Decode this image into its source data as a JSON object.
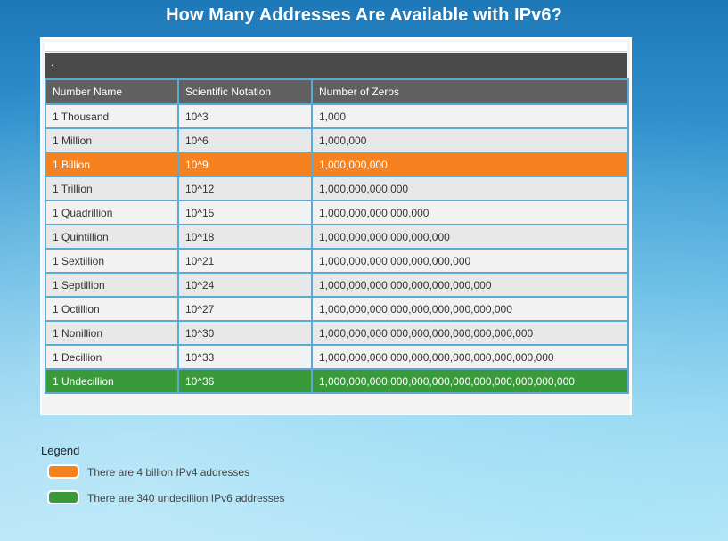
{
  "page": {
    "title": "How Many Addresses Are Available with IPv6?"
  },
  "table": {
    "caption": ".",
    "headers": [
      "Number Name",
      "Scientific Notation",
      "Number of Zeros"
    ],
    "rows": [
      [
        "1 Thousand",
        "10^3",
        "1,000"
      ],
      [
        "1 Million",
        "10^6",
        "1,000,000"
      ],
      [
        "1 Billion",
        "10^9",
        "1,000,000,000"
      ],
      [
        "1 Trillion",
        "10^12",
        "1,000,000,000,000"
      ],
      [
        "1 Quadrillion",
        "10^15",
        "1,000,000,000,000,000"
      ],
      [
        "1 Quintillion",
        "10^18",
        "1,000,000,000,000,000,000"
      ],
      [
        "1 Sextillion",
        "10^21",
        "1,000,000,000,000,000,000,000"
      ],
      [
        "1 Septillion",
        "10^24",
        "1,000,000,000,000,000,000,000,000"
      ],
      [
        "1 Octillion",
        "10^27",
        "1,000,000,000,000,000,000,000,000,000"
      ],
      [
        "1 Nonillion",
        "10^30",
        "1,000,000,000,000,000,000,000,000,000,000"
      ],
      [
        "1 Decillion",
        "10^33",
        "1,000,000,000,000,000,000,000,000,000,000,000"
      ],
      [
        "1 Undecillion",
        "10^36",
        "1,000,000,000,000,000,000,000,000,000,000,000,000"
      ]
    ],
    "highlight_colors": {
      "orange": "#f5821f",
      "green": "#3a9a3a"
    }
  },
  "legend": {
    "title": "Legend",
    "items": [
      {
        "color": "#f5821f",
        "text": "There are 4 billion IPv4 addresses"
      },
      {
        "color": "#3a9a3a",
        "text": "There are 340 undecillion IPv6 addresses"
      }
    ]
  }
}
